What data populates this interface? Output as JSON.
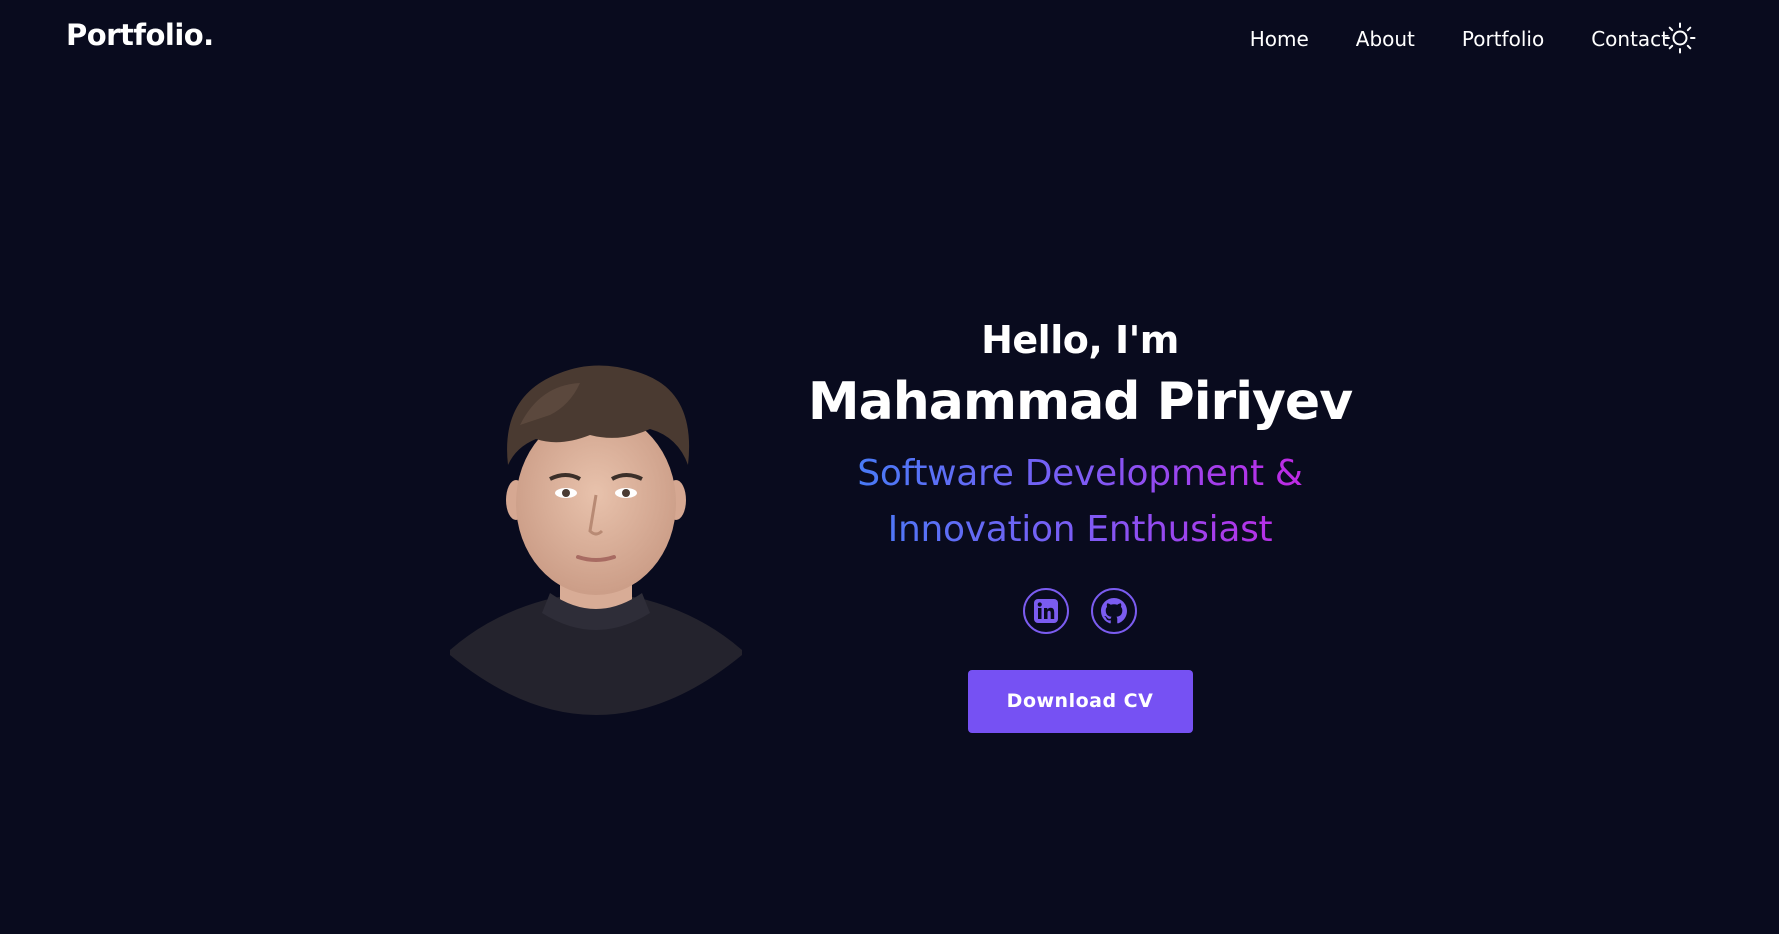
{
  "header": {
    "logo": "Portfolio.",
    "nav": [
      {
        "label": "Home"
      },
      {
        "label": "About"
      },
      {
        "label": "Portfolio"
      },
      {
        "label": "Contact"
      }
    ],
    "theme_icon": "sun-icon"
  },
  "hero": {
    "greeting": "Hello, I'm",
    "name": "Mahammad Piriyev",
    "tagline": "Software Development & Innovation Enthusiast",
    "socials": [
      {
        "icon": "linkedin-icon"
      },
      {
        "icon": "github-icon"
      }
    ],
    "cta_label": "Download CV"
  },
  "colors": {
    "background": "#090b1e",
    "accent": "#7651f3",
    "gradient_start": "#3b82f6",
    "gradient_mid": "#7c5cf5",
    "gradient_end": "#d11ce0"
  }
}
